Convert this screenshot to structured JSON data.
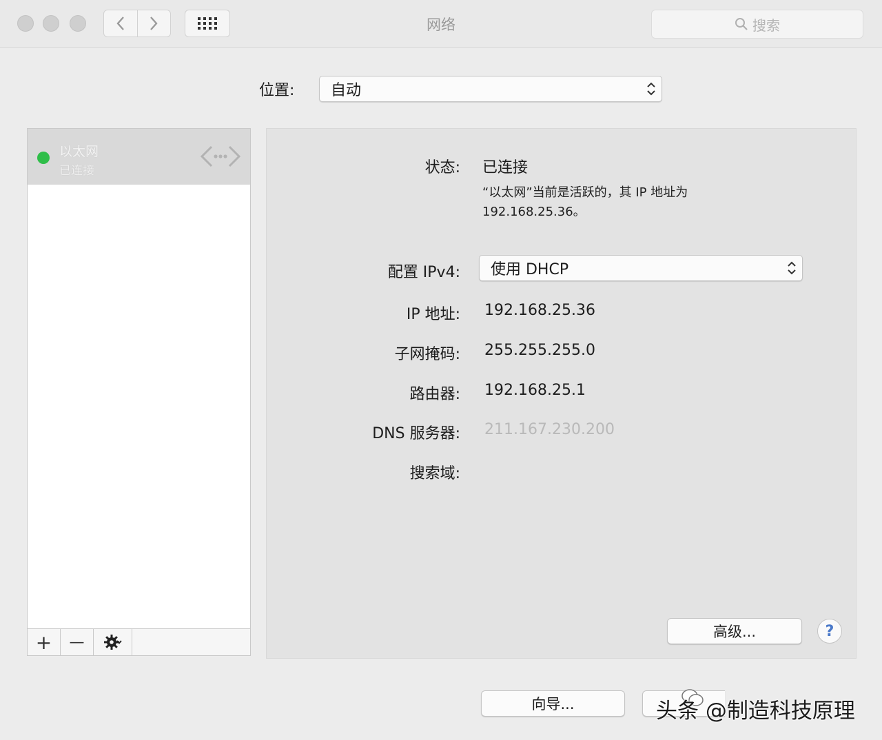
{
  "window": {
    "title": "网络",
    "search_placeholder": "搜索"
  },
  "toolbar": {
    "back_icon": "chevron-left-icon",
    "forward_icon": "chevron-right-icon",
    "grid_icon": "grid-icon"
  },
  "location": {
    "label": "位置:",
    "value": "自动"
  },
  "sidebar": {
    "services": [
      {
        "name": "以太网",
        "status": "已连接",
        "status_color": "#2fbe49",
        "icon": "ethernet-icon"
      }
    ],
    "add_label": "+",
    "remove_label": "—"
  },
  "details": {
    "status_label": "状态:",
    "status_value": "已连接",
    "status_desc_line1": "“以太网”当前是活跃的，其 IP 地址为",
    "status_desc_line2": "192.168.25.36。",
    "configure_label": "配置 IPv4:",
    "configure_value": "使用 DHCP",
    "ip_label": "IP 地址:",
    "ip_value": "192.168.25.36",
    "subnet_label": "子网掩码:",
    "subnet_value": "255.255.255.0",
    "router_label": "路由器:",
    "router_value": "192.168.25.1",
    "dns_label": "DNS 服务器:",
    "dns_value": "211.167.230.200",
    "search_domain_label": "搜索域:"
  },
  "buttons": {
    "advanced": "高级...",
    "help": "?",
    "assist": "向导..."
  },
  "watermark": "头条 @制造科技原理"
}
